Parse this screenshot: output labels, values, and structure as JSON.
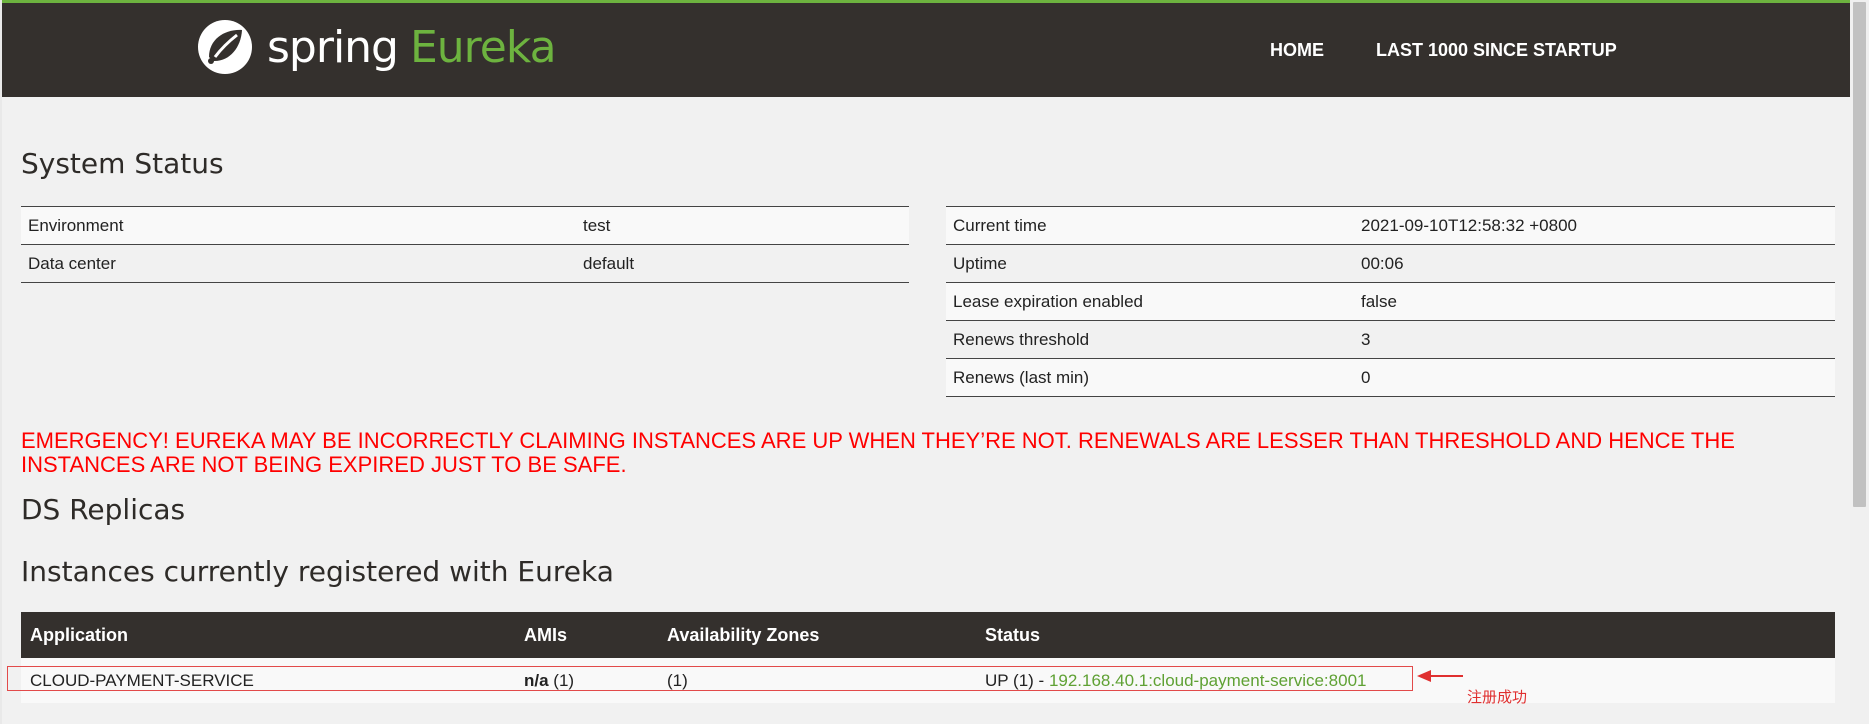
{
  "brand": {
    "spring": "spring",
    "eureka": "Eureka"
  },
  "nav": [
    "HOME",
    "LAST 1000 SINCE STARTUP"
  ],
  "system_status": {
    "title": "System Status",
    "left": [
      {
        "label": "Environment",
        "value": "test"
      },
      {
        "label": "Data center",
        "value": "default"
      }
    ],
    "right": [
      {
        "label": "Current time",
        "value": "2021-09-10T12:58:32 +0800"
      },
      {
        "label": "Uptime",
        "value": "00:06"
      },
      {
        "label": "Lease expiration enabled",
        "value": "false"
      },
      {
        "label": "Renews threshold",
        "value": "3"
      },
      {
        "label": "Renews (last min)",
        "value": "0"
      }
    ]
  },
  "emergency": "EMERGENCY! EUREKA MAY BE INCORRECTLY CLAIMING INSTANCES ARE UP WHEN THEY’RE NOT. RENEWALS ARE LESSER THAN THRESHOLD AND HENCE THE INSTANCES ARE NOT BEING EXPIRED JUST TO BE SAFE.",
  "ds_replicas": {
    "title": "DS Replicas"
  },
  "instances": {
    "title": "Instances currently registered with Eureka",
    "headers": [
      "Application",
      "AMIs",
      "Availability Zones",
      "Status"
    ],
    "rows": [
      {
        "application": "CLOUD-PAYMENT-SERVICE",
        "amis_bold": "n/a",
        "amis_count": "(1)",
        "zones": "(1)",
        "status_prefix": "UP (1) -",
        "status_link": "192.168.40.1:cloud-payment-service:8001"
      }
    ]
  },
  "annotation": {
    "text": "注册成功",
    "color": "#e03030"
  },
  "colors": {
    "accent": "#6db33f",
    "nav_bg": "#34302d",
    "emergency": "#ff0000"
  }
}
